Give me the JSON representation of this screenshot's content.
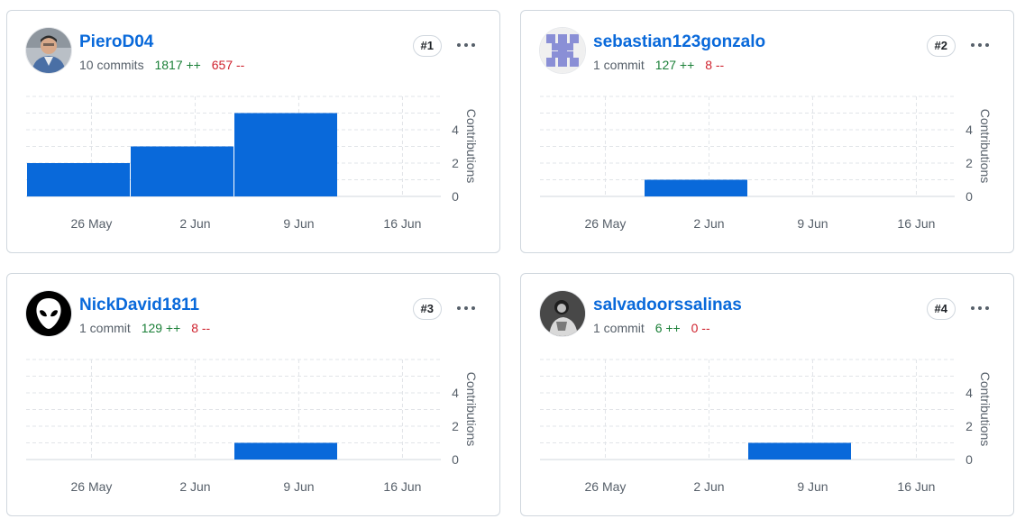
{
  "contributors": [
    {
      "username": "PieroD04",
      "commits_label": "10 commits",
      "additions": "1817 ++",
      "deletions": "657 --",
      "rank": "#1",
      "avatar_icon": "person-photo-avatar-icon",
      "weekly_contributions": [
        2,
        3,
        5,
        0
      ]
    },
    {
      "username": "sebastian123gonzalo",
      "commits_label": "1 commit",
      "additions": "127 ++",
      "deletions": "8 --",
      "rank": "#2",
      "avatar_icon": "identicon-avatar-icon",
      "weekly_contributions": [
        0,
        1,
        0,
        0
      ]
    },
    {
      "username": "NickDavid1811",
      "commits_label": "1 commit",
      "additions": "129 ++",
      "deletions": "8 --",
      "rank": "#3",
      "avatar_icon": "alien-avatar-icon",
      "weekly_contributions": [
        0,
        0,
        1,
        0
      ]
    },
    {
      "username": "salvadoorssalinas",
      "commits_label": "1 commit",
      "additions": "6 ++",
      "deletions": "0 --",
      "rank": "#4",
      "avatar_icon": "person-photo-dark-avatar-icon",
      "weekly_contributions": [
        0,
        0,
        1,
        0
      ]
    }
  ],
  "chart_data": {
    "type": "bar",
    "categories": [
      "26 May",
      "2 Jun",
      "9 Jun",
      "16 Jun"
    ],
    "ylabel": "Contributions",
    "yticks": [
      0,
      2,
      4
    ],
    "ylim": [
      0,
      6
    ],
    "grid": true,
    "series": [
      {
        "name": "PieroD04",
        "values": [
          2,
          3,
          5,
          0
        ]
      },
      {
        "name": "sebastian123gonzalo",
        "values": [
          0,
          1,
          0,
          0
        ]
      },
      {
        "name": "NickDavid1811",
        "values": [
          0,
          0,
          1,
          0
        ]
      },
      {
        "name": "salvadoorssalinas",
        "values": [
          0,
          0,
          1,
          0
        ]
      }
    ]
  },
  "colors": {
    "bar": "#0969da",
    "link": "#0969da",
    "additions": "#1a7f37",
    "deletions": "#cf222e",
    "grid": "#e1e4e8"
  },
  "more_icon": "kebab-horizontal-icon"
}
